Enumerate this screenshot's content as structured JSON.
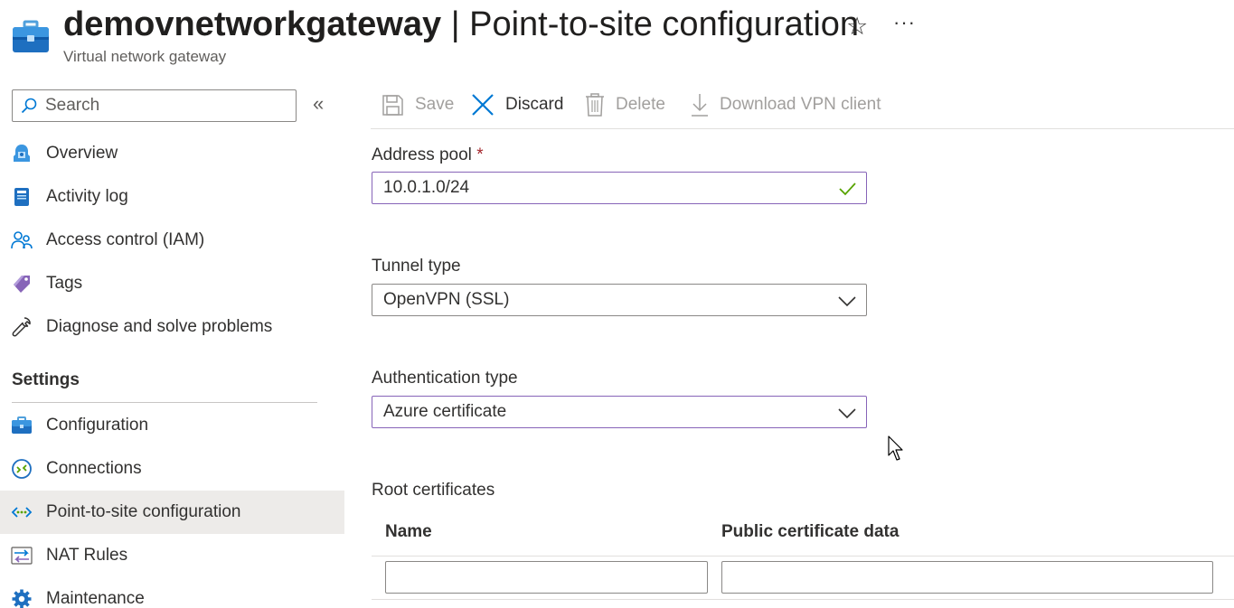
{
  "header": {
    "title_bold": "demovnetworkgateway",
    "title_rest": " | Point-to-site configuration",
    "subtitle": "Virtual network gateway",
    "star_icon": "star-outline-icon",
    "more_icon": "ellipsis-icon"
  },
  "sidebar": {
    "search_placeholder": "Search",
    "collapse_glyph": "«",
    "items_top": [
      {
        "label": "Overview",
        "icon": "overview-icon"
      },
      {
        "label": "Activity log",
        "icon": "activity-log-icon"
      },
      {
        "label": "Access control (IAM)",
        "icon": "iam-people-icon"
      },
      {
        "label": "Tags",
        "icon": "tag-icon"
      },
      {
        "label": "Diagnose and solve problems",
        "icon": "wrench-icon"
      }
    ],
    "section_settings": "Settings",
    "items_settings": [
      {
        "label": "Configuration",
        "icon": "configuration-icon"
      },
      {
        "label": "Connections",
        "icon": "connections-icon"
      },
      {
        "label": "Point-to-site configuration",
        "icon": "point-to-site-icon",
        "selected": true
      },
      {
        "label": "NAT Rules",
        "icon": "nat-rules-icon"
      },
      {
        "label": "Maintenance",
        "icon": "maintenance-gear-icon"
      }
    ]
  },
  "toolbar": {
    "save": "Save",
    "discard": "Discard",
    "delete": "Delete",
    "download": "Download VPN client"
  },
  "form": {
    "address_pool_label": "Address pool",
    "required_marker": "*",
    "address_pool_value": "10.0.1.0/24",
    "tunnel_type_label": "Tunnel type",
    "tunnel_type_value": "OpenVPN (SSL)",
    "auth_type_label": "Authentication type",
    "auth_type_value": "Azure certificate"
  },
  "root_certs": {
    "heading": "Root certificates",
    "col_name": "Name",
    "col_data": "Public certificate data"
  },
  "colors": {
    "accent_purple": "#8764b8",
    "valid_green": "#57a300",
    "azure_blue": "#0078d4",
    "selected_bg": "#edebe9"
  }
}
